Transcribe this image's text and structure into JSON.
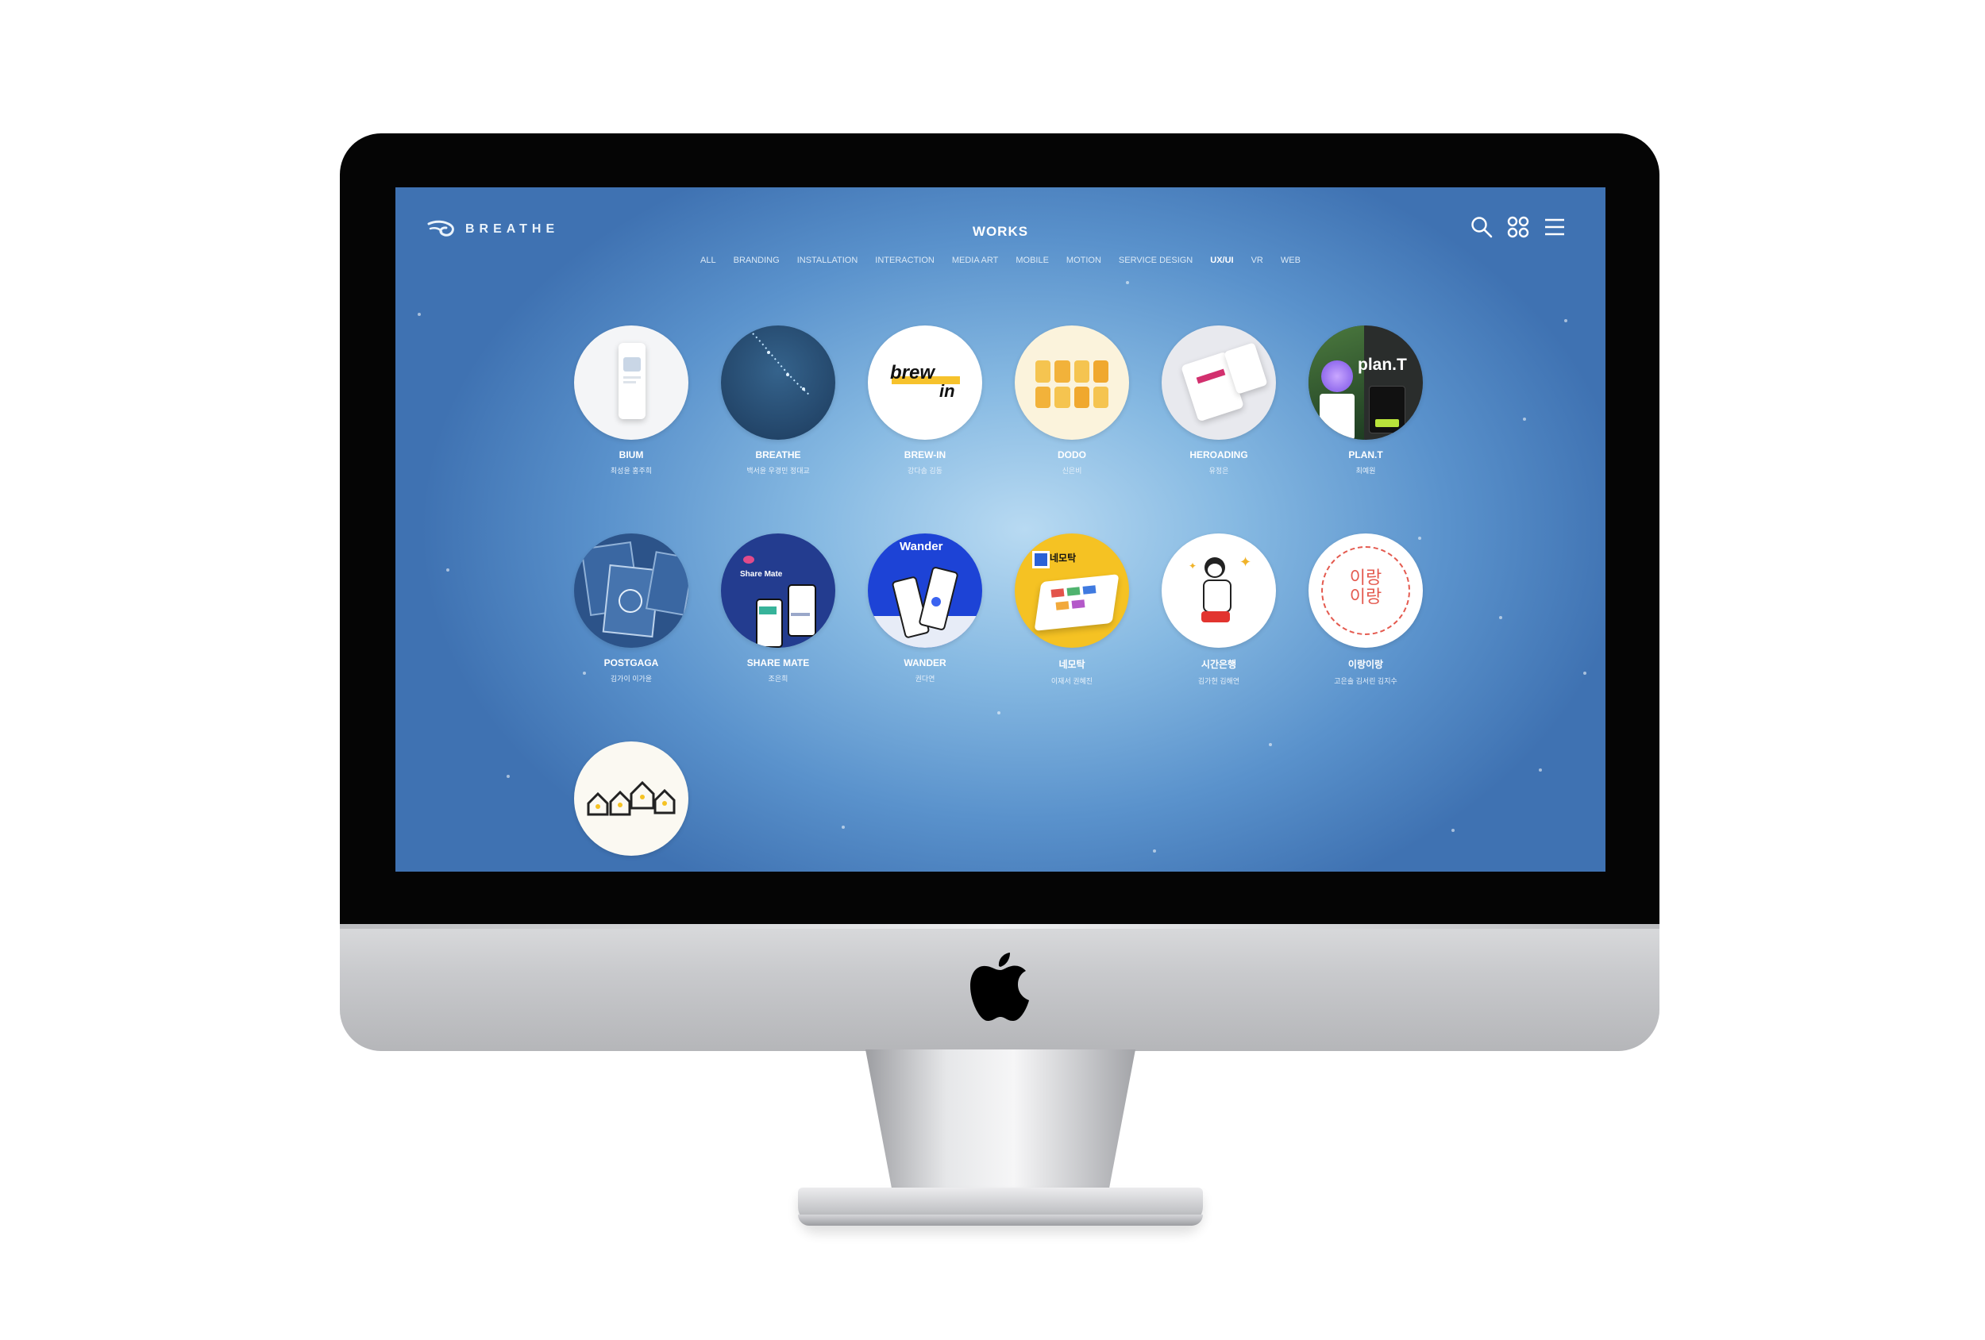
{
  "header": {
    "logo_text": "BREATHE",
    "title": "WORKS",
    "icons": [
      "search-icon",
      "grid-icon",
      "menu-icon"
    ]
  },
  "filters": [
    {
      "label": "ALL",
      "active": false
    },
    {
      "label": "BRANDING",
      "active": false
    },
    {
      "label": "INSTALLATION",
      "active": false
    },
    {
      "label": "INTERACTION",
      "active": false
    },
    {
      "label": "MEDIA ART",
      "active": false
    },
    {
      "label": "MOBILE",
      "active": false
    },
    {
      "label": "MOTION",
      "active": false
    },
    {
      "label": "SERVICE DESIGN",
      "active": false
    },
    {
      "label": "UX/UI",
      "active": true
    },
    {
      "label": "VR",
      "active": false
    },
    {
      "label": "WEB",
      "active": false
    }
  ],
  "works": [
    {
      "title": "BIUM",
      "authors": "최성윤 홍주희"
    },
    {
      "title": "BREATHE",
      "authors": "백서윤 우경민 정대교"
    },
    {
      "title": "BREW-IN",
      "authors": "강다솜 김동"
    },
    {
      "title": "DODO",
      "authors": "신은비"
    },
    {
      "title": "HEROADING",
      "authors": "유정은"
    },
    {
      "title": "PLAN.T",
      "authors": "최예원"
    },
    {
      "title": "POSTGAGA",
      "authors": "김가이 이가윤"
    },
    {
      "title": "SHARE MATE",
      "authors": "조은희"
    },
    {
      "title": "WANDER",
      "authors": "권다연"
    },
    {
      "title": "네모탁",
      "authors": "이재서 권혜진"
    },
    {
      "title": "시간은행",
      "authors": "김가현 김해연"
    },
    {
      "title": "이랑이랑",
      "authors": "고은솔 김서린 김지수"
    },
    {
      "title": "",
      "authors": ""
    }
  ],
  "thumb_text": {
    "brew_line1": "brew",
    "brew_line2": "in",
    "plant_logo": "plan.T",
    "sharemate_label": "Share Mate",
    "wander_logo": "Wander",
    "nemotak_label": "네모탁",
    "irang_line1": "이랑",
    "irang_line2": "이랑"
  },
  "colors": {
    "screen_center": "#b8daf2",
    "screen_edge": "#3f72b2",
    "bezel": "#050505",
    "chin": "#c8c9cc"
  }
}
